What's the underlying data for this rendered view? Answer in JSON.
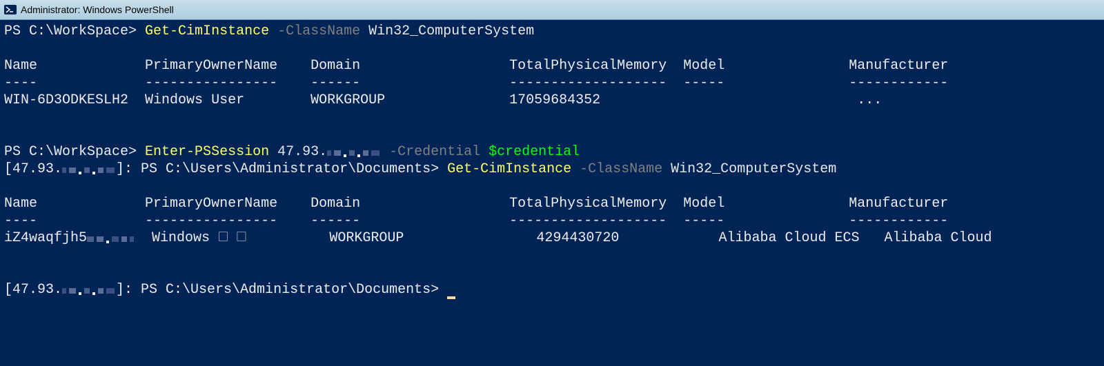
{
  "window": {
    "title": "Administrator: Windows PowerShell"
  },
  "prompt1": "PS C:\\WorkSpace> ",
  "cmd1": {
    "verb": "Get-CimInstance",
    "flag": " -ClassName ",
    "arg": "Win32_ComputerSystem"
  },
  "table1": {
    "headers": [
      "Name",
      "PrimaryOwnerName",
      "Domain",
      "TotalPhysicalMemory",
      "Model",
      "Manufacturer"
    ],
    "dividers": [
      "----",
      "----------------",
      "------",
      "-------------------",
      "-----",
      "------------"
    ],
    "row": {
      "Name": "WIN-6D3ODKESLH2",
      "PrimaryOwnerName": "Windows User",
      "Domain": "WORKGROUP",
      "TotalPhysicalMemory": "17059684352",
      "Model": "",
      "Manufacturer": "..."
    }
  },
  "prompt2": "PS C:\\WorkSpace> ",
  "cmd2": {
    "verb": "Enter-PSSession",
    "host_prefix": " 47.93.",
    "flag": " -Credential ",
    "var": "$credential"
  },
  "remote_prefix": "[47.93.",
  "remote_close": "]: ",
  "remote_prompt": "PS C:\\Users\\Administrator\\Documents> ",
  "cmd3": {
    "verb": "Get-CimInstance",
    "flag": " -ClassName ",
    "arg": "Win32_ComputerSystem"
  },
  "table2": {
    "headers": [
      "Name",
      "PrimaryOwnerName",
      "Domain",
      "TotalPhysicalMemory",
      "Model",
      "Manufacturer"
    ],
    "dividers": [
      "----",
      "----------------",
      "------",
      "-------------------",
      "-----",
      "------------"
    ],
    "row": {
      "Name_prefix": "iZ4waqfjh5",
      "PrimaryOwnerName": "Windows 🗆 🗆",
      "Domain": "WORKGROUP",
      "TotalPhysicalMemory": "4294430720",
      "Model": "Alibaba Cloud ECS",
      "Manufacturer": "Alibaba Cloud"
    }
  },
  "spacing": {
    "t_col1_w": 17,
    "t_col2_w": 20,
    "t_col3_w": 24,
    "t_col4_w": 21,
    "t_col5_w": 19
  }
}
